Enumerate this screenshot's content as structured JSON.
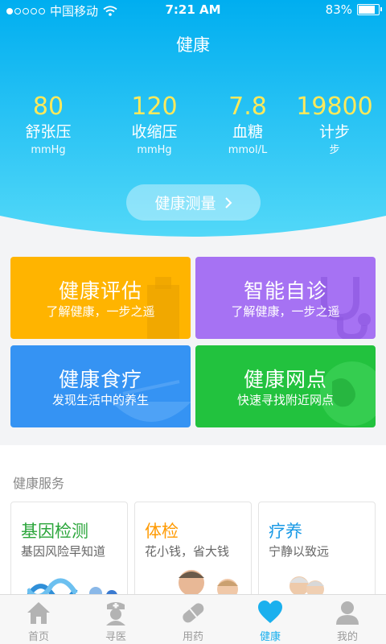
{
  "status": {
    "carrier": "中国移动",
    "time": "7:21 AM",
    "battery": "83%"
  },
  "header": {
    "title": "健康"
  },
  "metrics": [
    {
      "value": "80",
      "name": "舒张压",
      "unit": "mmHg"
    },
    {
      "value": "120",
      "name": "收缩压",
      "unit": "mmHg"
    },
    {
      "value": "7.8",
      "name": "血糖",
      "unit": "mmol/L"
    },
    {
      "value": "19800",
      "name": "计步",
      "unit": "步"
    }
  ],
  "measure_button": {
    "label": "健康测量"
  },
  "tiles": [
    {
      "title": "健康评估",
      "subtitle": "了解健康，一步之遥"
    },
    {
      "title": "智能自诊",
      "subtitle": "了解健康，一步之遥"
    },
    {
      "title": "健康食疗",
      "subtitle": "发现生活中的养生"
    },
    {
      "title": "健康网点",
      "subtitle": "快速寻找附近网点"
    }
  ],
  "services": {
    "title": "健康服务",
    "cards": [
      {
        "title": "基因检测",
        "subtitle": "基因风险早知道"
      },
      {
        "title": "体检",
        "subtitle": "花小钱，省大钱"
      },
      {
        "title": "疗养",
        "subtitle": "宁静以致远"
      }
    ]
  },
  "tabbar": [
    {
      "label": "首页"
    },
    {
      "label": "寻医"
    },
    {
      "label": "用药"
    },
    {
      "label": "健康"
    },
    {
      "label": "我的"
    }
  ],
  "colors": {
    "hero_top": "#00b4f2",
    "hero_bottom": "#4fd8f8",
    "metric_value": "#ffe95a",
    "tile_orange": "#ffb400",
    "tile_purple": "#a672f3",
    "tile_blue": "#3593f3",
    "tile_green": "#22c23e",
    "card_green": "#2aa53a",
    "card_orange": "#ff9a00",
    "card_blue": "#1a9ae6",
    "tab_active": "#1ab0ee"
  }
}
